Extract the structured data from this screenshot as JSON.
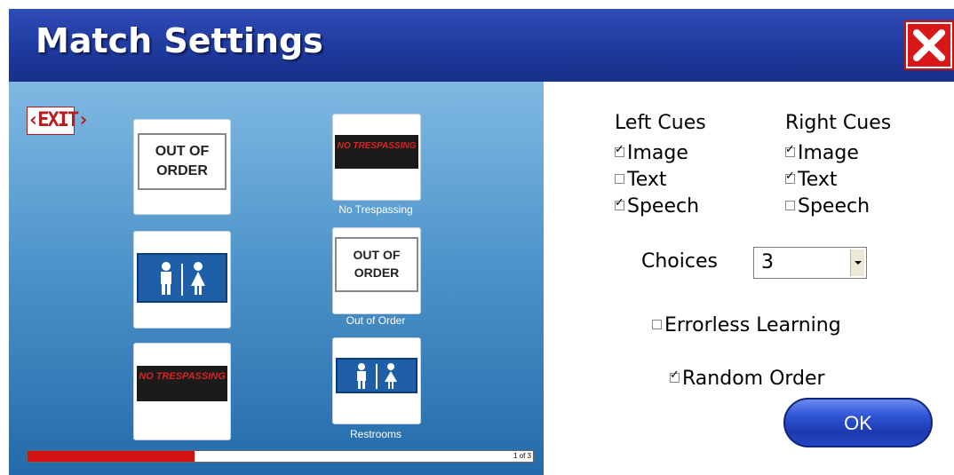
{
  "dialog": {
    "title": "Match Settings",
    "close_icon": "close-icon"
  },
  "preview": {
    "exit_sign": "‹EXIT›",
    "cards": {
      "c1": {
        "sign_text": "OUT OF ORDER"
      },
      "c2": {
        "sign_text": "NO TRESPASSING",
        "caption": "No Trespassing"
      },
      "c4": {
        "sign_text": "OUT OF ORDER",
        "caption": "Out of Order"
      },
      "c5": {
        "sign_text": "NO TRESPASSING"
      },
      "c6": {
        "caption": "Restrooms"
      }
    },
    "progress": {
      "value_fraction": 0.33,
      "count_text": "1 of 3"
    }
  },
  "settings": {
    "left_cues": {
      "heading": "Left Cues",
      "image": {
        "label": "Image",
        "checked": true
      },
      "text": {
        "label": "Text",
        "checked": false
      },
      "speech": {
        "label": "Speech",
        "checked": true
      }
    },
    "right_cues": {
      "heading": "Right Cues",
      "image": {
        "label": "Image",
        "checked": true
      },
      "text": {
        "label": "Text",
        "checked": true
      },
      "speech": {
        "label": "Speech",
        "checked": false
      }
    },
    "choices": {
      "label": "Choices",
      "value": "3"
    },
    "errorless_learning": {
      "label": "Errorless Learning",
      "checked": false
    },
    "random_order": {
      "label": "Random Order",
      "checked": true
    },
    "ok_label": "OK"
  }
}
